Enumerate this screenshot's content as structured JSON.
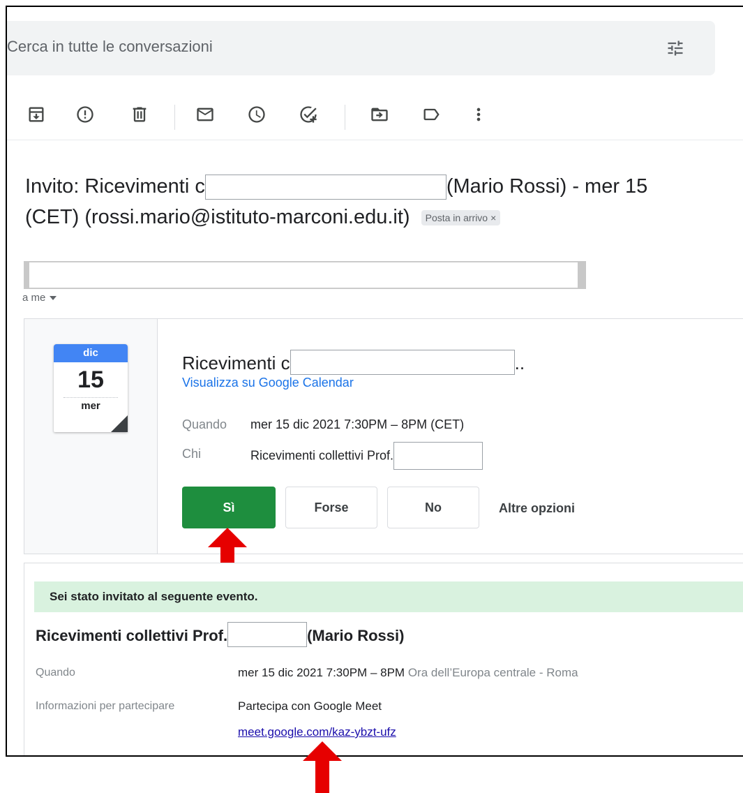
{
  "search": {
    "placeholder": "Cerca in tutte le conversazioni"
  },
  "icons": {
    "archive": "archive-icon",
    "spam": "report-spam-icon",
    "delete": "delete-icon",
    "unread": "mark-unread-icon",
    "snooze": "snooze-icon",
    "task": "add-task-icon",
    "move": "move-to-icon",
    "label": "label-icon",
    "more": "more-vert-icon",
    "tune": "tune-icon"
  },
  "subject": {
    "part1": "Invito: Ricevimenti c",
    "part2": "(Mario Rossi) - mer 15",
    "part3": "(CET) (rossi.mario@istituto-marconi.edu.it)",
    "label": "Posta in arrivo",
    "label_close": "×"
  },
  "recipient": {
    "text": "a me"
  },
  "invite": {
    "calendar": {
      "month": "dic",
      "day": "15",
      "weekday": "mer"
    },
    "title": "Ricevimenti c",
    "title_suffix": "..",
    "gcal_link": "Visualizza su Google Calendar",
    "when_label": "Quando",
    "when_value": "mer 15 dic 2021 7:30PM – 8PM (CET)",
    "who_label": "Chi",
    "who_value": "Ricevimenti collettivi Prof.",
    "buttons": {
      "yes": "Sì",
      "maybe": "Forse",
      "no": "No",
      "more": "Altre opzioni"
    }
  },
  "details": {
    "banner": "Sei stato invitato al seguente evento.",
    "title_part1": "Ricevimenti collettivi Prof.",
    "title_part2": "(Mario Rossi)",
    "when_label": "Quando",
    "when_value": "mer 15 dic 2021 7:30PM – 8PM",
    "when_tz": "Ora dell’Europa centrale - Roma",
    "join_label": "Informazioni per partecipare",
    "join_value": "Partecipa con Google Meet",
    "meet_link": "meet.google.com/kaz-ybzt-ufz"
  },
  "colors": {
    "accept": "#1e8e3e",
    "link": "#1a73e8",
    "arrow": "#e60000",
    "banner": "#d9f2df"
  }
}
